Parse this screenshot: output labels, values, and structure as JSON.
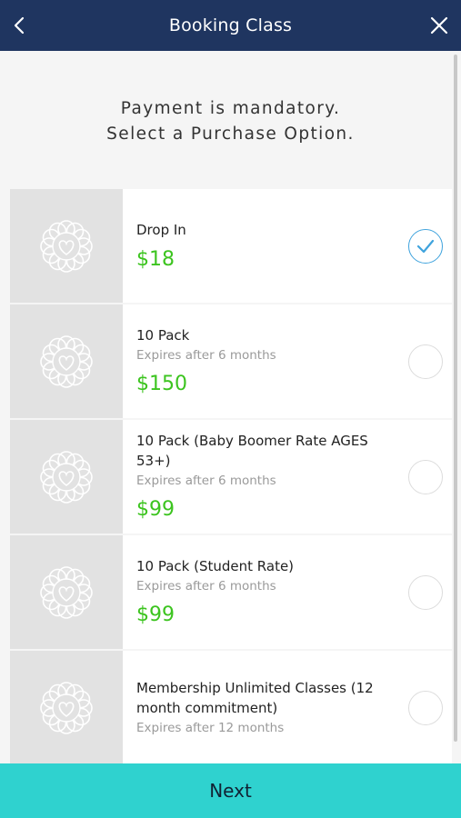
{
  "header": {
    "title": "Booking Class",
    "back_icon": "chevron-left-icon",
    "close_icon": "close-icon"
  },
  "notice": {
    "line1": "Payment is mandatory.",
    "line2": "Select a Purchase Option."
  },
  "options": [
    {
      "name": "Drop In",
      "expires": "",
      "price": "$18",
      "selected": true
    },
    {
      "name": "10 Pack",
      "expires": "Expires after 6 months",
      "price": "$150",
      "selected": false
    },
    {
      "name": "10 Pack (Baby Boomer Rate AGES 53+)",
      "expires": "Expires after 6 months",
      "price": "$99",
      "selected": false
    },
    {
      "name": "10 Pack (Student Rate)",
      "expires": "Expires after 6 months",
      "price": "$99",
      "selected": false
    },
    {
      "name": "Membership Unlimited Classes (12 month commitment)",
      "expires": "Expires after 12 months",
      "price": "",
      "selected": false
    }
  ],
  "footer": {
    "next_label": "Next"
  },
  "colors": {
    "header_bg": "#1f3560",
    "price_green": "#3cc41f",
    "check_blue": "#3fa3dd",
    "next_bg": "#2fd2cf"
  }
}
